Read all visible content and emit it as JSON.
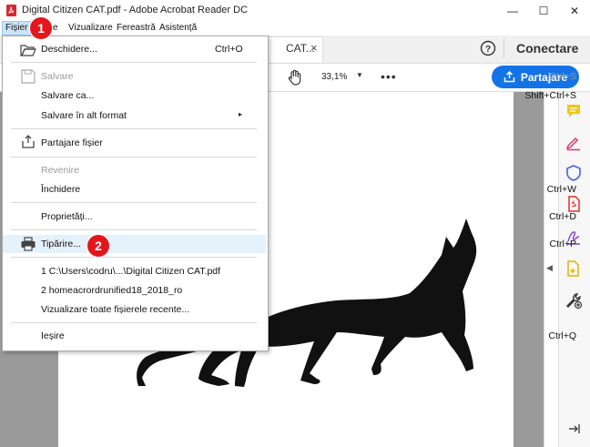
{
  "window": {
    "title": "Digital Citizen CAT.pdf - Adobe Acrobat Reader DC",
    "minimize": "—",
    "maximize": "☐",
    "close": "✕"
  },
  "menubar": {
    "items": [
      "Fișier",
      "Editare",
      "Vizualizare",
      "Fereastră",
      "Asistență"
    ],
    "visible_second_fragment": "e"
  },
  "tabs": {
    "doc_tab_label": "CAT...",
    "close": "×"
  },
  "header": {
    "sign_in": "Conectare",
    "share_button": "Partajare"
  },
  "toolbar": {
    "zoom": "33,1%",
    "more": "•••"
  },
  "file_menu": {
    "items": [
      {
        "label": "Deschidere...",
        "shortcut": "Ctrl+O",
        "enabled": true
      },
      {
        "label": "Salvare",
        "shortcut": "Ctrl+S",
        "enabled": false
      },
      {
        "label": "Salvare ca...",
        "shortcut": "Shift+Ctrl+S",
        "enabled": true
      },
      {
        "label": "Salvare în alt format",
        "shortcut": "▸",
        "enabled": true
      },
      {
        "label": "Partajare fișier",
        "shortcut": "",
        "enabled": true
      },
      {
        "label": "Revenire",
        "shortcut": "",
        "enabled": false
      },
      {
        "label": "Închidere",
        "shortcut": "Ctrl+W",
        "enabled": true
      },
      {
        "label": "Proprietăți...",
        "shortcut": "Ctrl+D",
        "enabled": true
      },
      {
        "label": "Tipărire...",
        "shortcut": "Ctrl+P",
        "enabled": true
      },
      {
        "label": "1 C:\\Users\\codru\\...\\Digital Citizen CAT.pdf",
        "shortcut": "",
        "enabled": true
      },
      {
        "label": "2 homeacrordrunified18_2018_ro",
        "shortcut": "",
        "enabled": true
      },
      {
        "label": "Vizualizare toate fișierele recente...",
        "shortcut": "",
        "enabled": true
      },
      {
        "label": "Ieșire",
        "shortcut": "Ctrl+Q",
        "enabled": true
      }
    ]
  },
  "badges": {
    "one": "1",
    "two": "2"
  },
  "colors": {
    "accent_blue": "#1473e6",
    "badge_red": "#e4161c",
    "highlight": "#e5f1fb"
  }
}
